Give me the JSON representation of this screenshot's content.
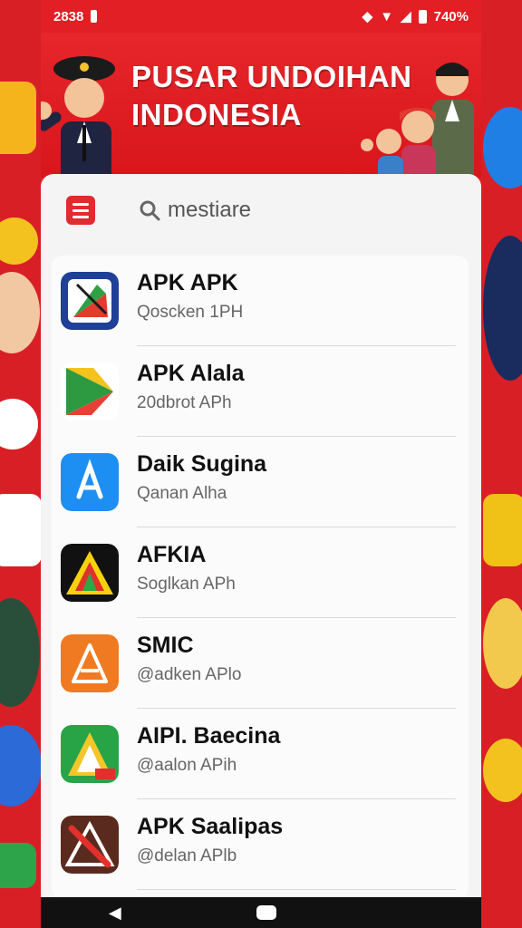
{
  "status_bar": {
    "time": "2838",
    "battery": "740%"
  },
  "banner": {
    "title_line1": "PUSAR UNDOIHAN",
    "title_line2": "INDONESIA"
  },
  "search": {
    "placeholder": "mestiare"
  },
  "apps": [
    {
      "title": "APK APK",
      "subtitle": "Qoscken 1PH",
      "icon": "pencil-ruler-icon",
      "colors": [
        "#1f3f98",
        "#e23b2f",
        "#2fa043"
      ]
    },
    {
      "title": "APK Alala",
      "subtitle": "20dbrot APh",
      "icon": "play-store-icon",
      "colors": [
        "#2d9a42",
        "#e84034",
        "#f6c21c"
      ]
    },
    {
      "title": "Daik Sugina",
      "subtitle": "Qanan Alha",
      "icon": "app-store-a-icon",
      "colors": [
        "#1e8ff2",
        "#ffffff"
      ]
    },
    {
      "title": "AFKIA",
      "subtitle": "Soglkan APh",
      "icon": "triangle-stripes-icon",
      "colors": [
        "#111111",
        "#f5d20c",
        "#e2302d",
        "#2ea64a"
      ]
    },
    {
      "title": "SMIC",
      "subtitle": "@adken APlo",
      "icon": "a-triangle-icon",
      "colors": [
        "#f07a22",
        "#ffffff"
      ]
    },
    {
      "title": "AIPI. Baecina",
      "subtitle": "@aalon APih",
      "icon": "green-triangle-icon",
      "colors": [
        "#28a447",
        "#f4c62a",
        "#e2302d"
      ]
    },
    {
      "title": "APK Saalipas",
      "subtitle": "@delan APlb",
      "icon": "x-triangle-icon",
      "colors": [
        "#5a2a1e",
        "#e2302d"
      ]
    }
  ]
}
